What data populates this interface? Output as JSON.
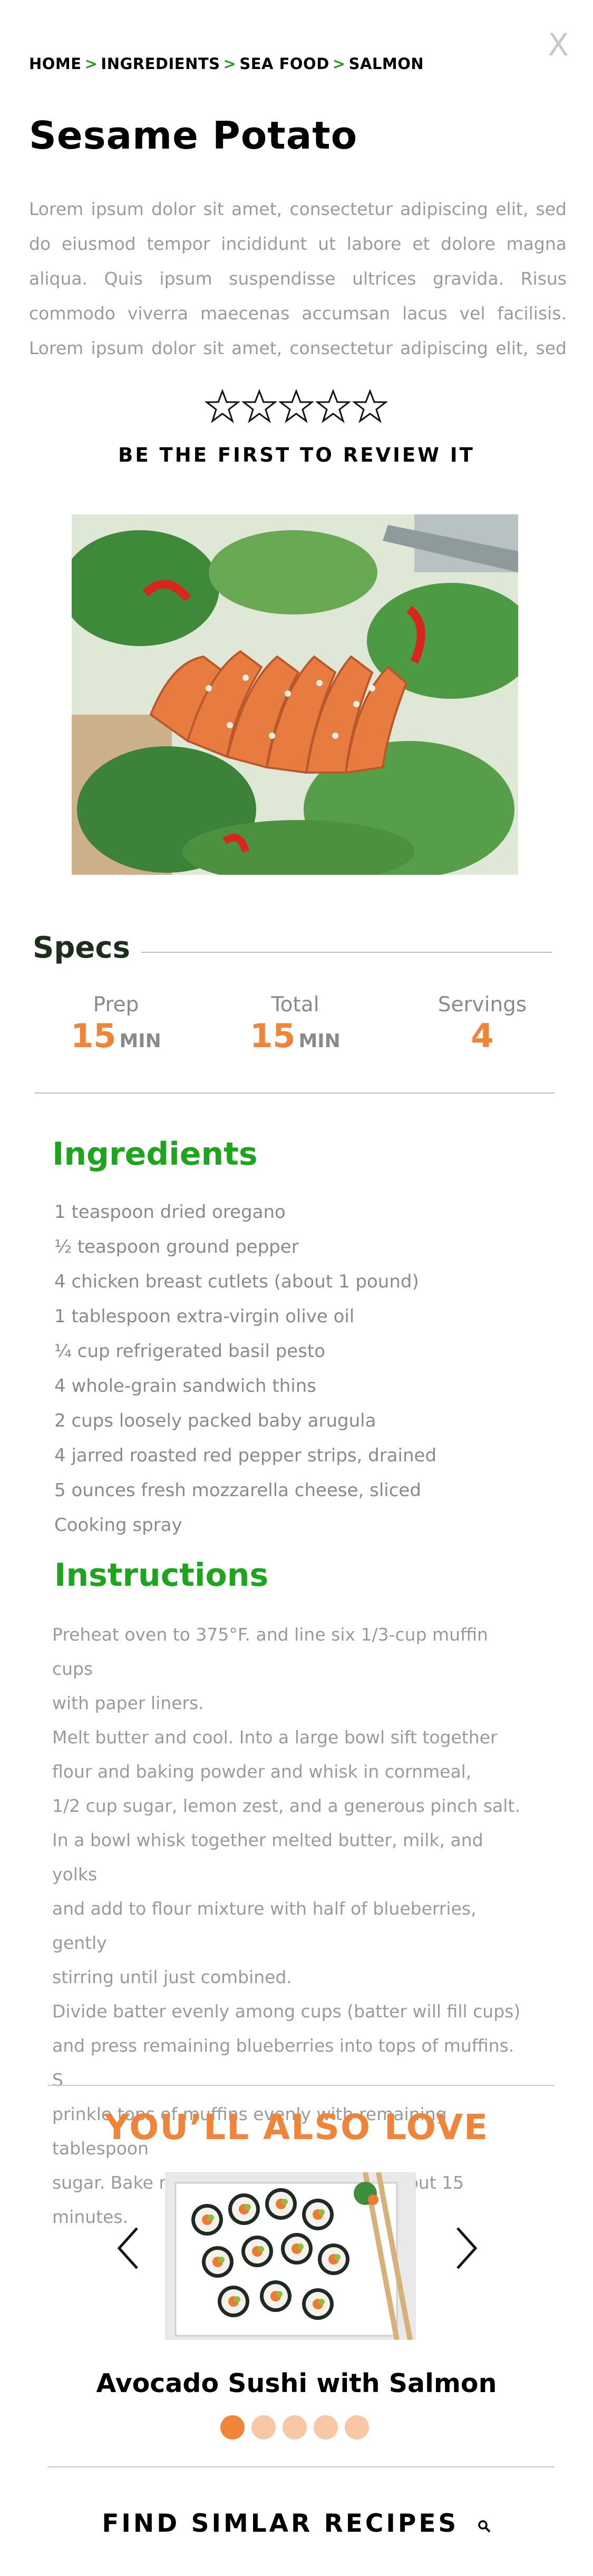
{
  "breadcrumb": [
    "HOME",
    "INGREDIENTS",
    "SEA FOOD",
    "SALMON"
  ],
  "breadcrumb_sep": ">",
  "close_label": "X",
  "title": "Sesame Potato",
  "intro": "Lorem ipsum dolor sit amet, consectetur adipiscing elit, sed do eiusmod tempor incididunt ut labore et dolore magna aliqua. Quis ipsum suspendisse ultrices gravida. Risus commodo viverra maecenas accumsan lacus vel facilisis. Lorem ipsum dolor sit amet, consectetur adipiscing elit, sed do eiusmod",
  "rating": {
    "stars": 0,
    "max": 5,
    "label": "BE THE FIRST TO REVIEW IT"
  },
  "specs": {
    "heading": "Specs",
    "prep": {
      "label": "Prep",
      "value": "15",
      "unit": "MIN"
    },
    "total": {
      "label": "Total",
      "value": "15",
      "unit": "MIN"
    },
    "servings": {
      "label": "Servings",
      "value": "4"
    }
  },
  "ingredients": {
    "heading": "Ingredients",
    "items": [
      "1 teaspoon dried oregano",
      "½ teaspoon ground pepper",
      "4 chicken breast cutlets (about 1 pound)",
      "1 tablespoon extra-virgin olive oil",
      "¼ cup refrigerated basil pesto",
      "4 whole-grain sandwich thins",
      "2 cups loosely packed baby arugula",
      "4 jarred roasted red pepper strips, drained",
      "5 ounces fresh mozzarella cheese, sliced",
      "Cooking spray"
    ]
  },
  "instructions": {
    "heading": "Instructions",
    "lines": [
      "Preheat oven to 375°F. and line six 1/3-cup muffin cups",
      "with paper liners.",
      "Melt butter and cool. Into a large bowl sift together",
      "flour and baking powder and whisk in cornmeal,",
      "1/2 cup sugar, lemon zest, and a generous pinch salt.",
      "In a bowl whisk together melted butter, milk, and yolks",
      "and add to flour mixture with half of blueberries, gently",
      "stirring until just combined.",
      "Divide batter evenly among cups (batter will fill cups)",
      "and press remaining blueberries into tops of muffins. S",
      "prinkle tops of muffins evenly with remaining tablespoon",
      "sugar. Bake muffins in middle of oven about 15 minutes."
    ]
  },
  "also_love": {
    "heading": "YOU’LL ALSO LOVE",
    "recipe_name": "Avocado Sushi with Salmon",
    "slides": 5,
    "active_slide": 0
  },
  "find_similar": "FIND SIMLAR RECIPES",
  "colors": {
    "accent": "#f0853a",
    "green": "#1ea51e",
    "text_muted": "#9b9b9b"
  },
  "icons": [
    "close-icon",
    "star-outline-icon",
    "chevron-left-icon",
    "chevron-right-icon",
    "search-icon"
  ]
}
